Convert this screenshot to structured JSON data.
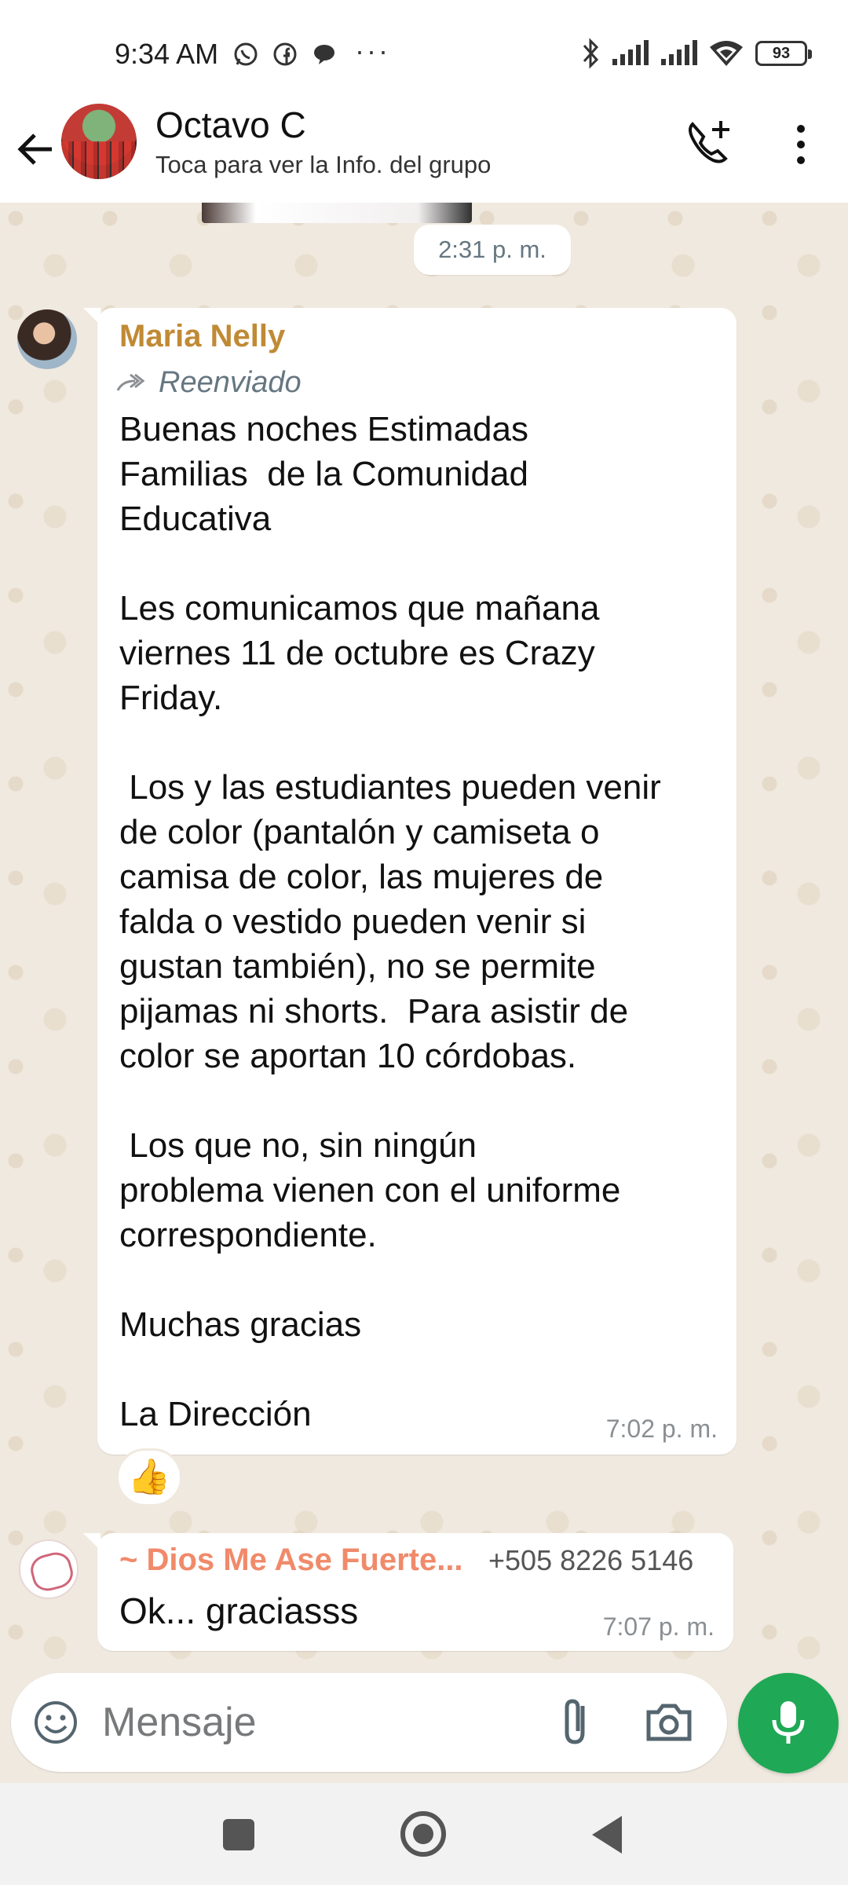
{
  "status_bar": {
    "time": "9:34 AM",
    "battery": "93",
    "app_icons": [
      "whatsapp-icon",
      "facebook-icon",
      "chat-bubble-icon"
    ],
    "right_icons": [
      "bluetooth-icon",
      "signal-icon",
      "signal-icon",
      "wifi-icon",
      "battery-icon"
    ],
    "more": "···"
  },
  "header": {
    "title": "Octavo C",
    "subtitle": "Toca para ver la Info. del grupo",
    "icons": [
      "back-arrow-icon",
      "call-add-icon",
      "more-vertical-icon"
    ]
  },
  "chat": {
    "date_chip": "2:31 p. m.",
    "messages": [
      {
        "sender": "Maria Nelly",
        "forwarded_label": "Reenviado",
        "text": "Buenas noches Estimadas\nFamilias  de la Comunidad\nEducativa\n\nLes comunicamos que mañana\nviernes 11 de octubre es Crazy\nFriday.\n\n Los y las estudiantes pueden venir\nde color (pantalón y camiseta o\ncamisa de color, las mujeres de\nfalda o vestido pueden venir si\ngustan también), no se permite\npijamas ni shorts.  Para asistir de\ncolor se aportan 10 córdobas.\n\n Los que no, sin ningún\nproblema vienen con el uniforme\ncorrespondiente.\n\nMuchas gracias\n\nLa Dirección",
        "time": "7:02 p. m.",
        "reaction": "👍"
      },
      {
        "sender": "~ Dios Me Ase Fuerte...",
        "phone": "+505 8226 5146",
        "text": "Ok... graciasss",
        "time": "7:07 p. m."
      }
    ]
  },
  "composer": {
    "placeholder": "Mensaje",
    "icons": [
      "emoji-icon",
      "paperclip-icon",
      "camera-icon",
      "mic-icon"
    ]
  },
  "colors": {
    "accent_green": "#1fa855",
    "sender1": "#c08a35",
    "sender2": "#f08a6a",
    "chat_bg": "#f0e9df"
  }
}
